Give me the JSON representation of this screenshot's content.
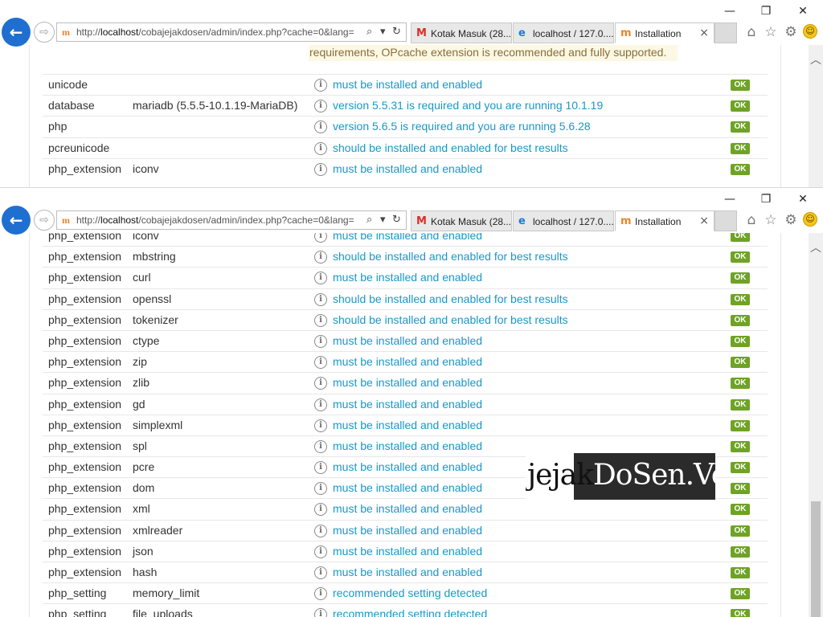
{
  "browser": {
    "address_url_host": "localhost",
    "address_url_prefix": "http://",
    "address_url_path": "/cobajejakdosen/admin/index.php?cache=0&lang=",
    "search_icon": "search-icon",
    "tabs": [
      {
        "label": "Kotak Masuk (28...",
        "icon": "gmail-icon"
      },
      {
        "label": "localhost / 127.0....",
        "icon": "ie-icon"
      },
      {
        "label": "Installation",
        "icon": "moodle-icon",
        "close": "×"
      }
    ],
    "window_controls": {
      "minimize": "—",
      "maximize": "❐",
      "close": "✕"
    },
    "back_glyph": "←",
    "forward_glyph": "⇨"
  },
  "top": {
    "notice": "requirements, OPcache extension is recommended and fully supported.",
    "rows": [
      {
        "name": "unicode",
        "value": "",
        "status": "must be installed and enabled",
        "badge": "OK"
      },
      {
        "name": "database",
        "value": "mariadb (5.5.5-10.1.19-MariaDB)",
        "status": "version 5.5.31 is required and you are running 10.1.19",
        "badge": "OK"
      },
      {
        "name": "php",
        "value": "",
        "status": "version 5.6.5 is required and you are running 5.6.28",
        "badge": "OK"
      },
      {
        "name": "pcreunicode",
        "value": "",
        "status": "should be installed and enabled for best results",
        "badge": "OK"
      },
      {
        "name": "php_extension",
        "value": "iconv",
        "status": "must be installed and enabled",
        "badge": "OK"
      }
    ]
  },
  "bottom": {
    "rows": [
      {
        "name": "php_extension",
        "value": "iconv",
        "status": "must be installed and enabled",
        "badge": "OK"
      },
      {
        "name": "php_extension",
        "value": "mbstring",
        "status": "should be installed and enabled for best results",
        "badge": "OK"
      },
      {
        "name": "php_extension",
        "value": "curl",
        "status": "must be installed and enabled",
        "badge": "OK"
      },
      {
        "name": "php_extension",
        "value": "openssl",
        "status": "should be installed and enabled for best results",
        "badge": "OK"
      },
      {
        "name": "php_extension",
        "value": "tokenizer",
        "status": "should be installed and enabled for best results",
        "badge": "OK"
      },
      {
        "name": "php_extension",
        "value": "ctype",
        "status": "must be installed and enabled",
        "badge": "OK"
      },
      {
        "name": "php_extension",
        "value": "zip",
        "status": "must be installed and enabled",
        "badge": "OK"
      },
      {
        "name": "php_extension",
        "value": "zlib",
        "status": "must be installed and enabled",
        "badge": "OK"
      },
      {
        "name": "php_extension",
        "value": "gd",
        "status": "must be installed and enabled",
        "badge": "OK"
      },
      {
        "name": "php_extension",
        "value": "simplexml",
        "status": "must be installed and enabled",
        "badge": "OK"
      },
      {
        "name": "php_extension",
        "value": "spl",
        "status": "must be installed and enabled",
        "badge": "OK"
      },
      {
        "name": "php_extension",
        "value": "pcre",
        "status": "must be installed and enabled",
        "badge": "OK"
      },
      {
        "name": "php_extension",
        "value": "dom",
        "status": "must be installed and enabled",
        "badge": "OK"
      },
      {
        "name": "php_extension",
        "value": "xml",
        "status": "must be installed and enabled",
        "badge": "OK"
      },
      {
        "name": "php_extension",
        "value": "xmlreader",
        "status": "must be installed and enabled",
        "badge": "OK"
      },
      {
        "name": "php_extension",
        "value": "json",
        "status": "must be installed and enabled",
        "badge": "OK"
      },
      {
        "name": "php_extension",
        "value": "hash",
        "status": "must be installed and enabled",
        "badge": "OK"
      },
      {
        "name": "php_setting",
        "value": "memory_limit",
        "status": "recommended setting detected",
        "badge": "OK"
      },
      {
        "name": "php_setting",
        "value": "file_uploads",
        "status": "recommended setting detected",
        "badge": "OK"
      }
    ]
  },
  "watermark": {
    "text_dark": "jejak",
    "text_light": "DoSen.Vol!!"
  },
  "colors": {
    "accent": "#1e6fd0",
    "status_text": "#1a97c9",
    "ok_badge": "#6fa325",
    "notice_bg": "#fcf8e3",
    "notice_text": "#8a6d3b"
  }
}
